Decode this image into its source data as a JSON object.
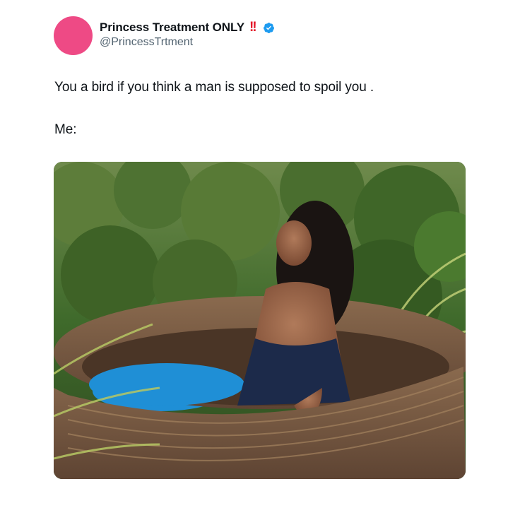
{
  "tweet": {
    "display_name": "Princess Treatment ONLY",
    "emoji": "!!",
    "handle": "@PrincessTrtment",
    "text_line1": "You a bird if you think a man is supposed to spoil you .",
    "text_line2": "Me:"
  },
  "colors": {
    "avatar": "#ee4a85",
    "verified": "#1d9bf0",
    "emoji": "#e3172a"
  },
  "icons": [
    "verified-badge-icon",
    "double-exclamation-emoji-icon"
  ],
  "media": {
    "alt": "photo"
  }
}
